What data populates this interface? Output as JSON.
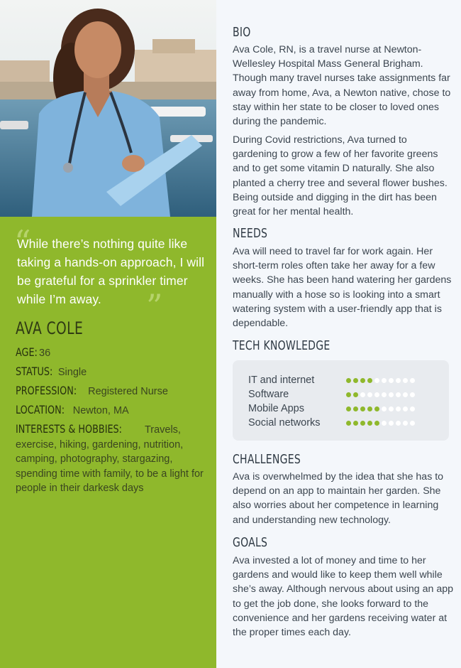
{
  "profile": {
    "quote": "While there’s nothing quite like taking a hands-on approach, I will be grateful for a sprinkler timer while I’m away.",
    "name": "AVA COLE",
    "facts": [
      {
        "label": "AGE:",
        "value": "36"
      },
      {
        "label": "STATUS:",
        "value": "Single"
      },
      {
        "label": "PROFESSION:",
        "value": "Registered Nurse"
      },
      {
        "label": "LOCATION:",
        "value": "Newton, MA"
      },
      {
        "label": "INTERESTS & HOBBIES:",
        "value": "Travels, exercise, hiking, gardening, nutrition, camping, photography, stargazing, spending time with family, to be a light for people in their darkesk days"
      }
    ]
  },
  "bio": {
    "title": "BIO",
    "p1": "Ava Cole, RN, is a travel nurse at Newton-Wellesley Hospital Mass General Brigham. Though many travel nurses take assignments far away from home, Ava, a Newton native, chose to stay within her state to be closer to loved ones during the pandemic.",
    "p2": "During Covid restrictions, Ava turned to gardening to grow a few of her favorite greens and to get some vitamin D naturally. She also planted a cherry tree and several flower bushes. Being outside and digging in the dirt has been great for her mental health."
  },
  "needs": {
    "title": "NEEDS",
    "text": "Ava will need to travel far for work again. Her short-term roles often take her away for a few weeks. She has been hand watering her gardens manually with a hose so is looking into a smart watering system with a user-friendly app that is dependable."
  },
  "tech": {
    "title": "TECH KNOWLEDGE",
    "max": 10,
    "items": [
      {
        "label": "IT and internet",
        "level": 4
      },
      {
        "label": "Software",
        "level": 2
      },
      {
        "label": "Mobile Apps",
        "level": 5
      },
      {
        "label": "Social networks",
        "level": 5
      }
    ]
  },
  "challenges": {
    "title": "CHALLENGES",
    "text": "Ava is overwhelmed by the idea that she has to depend on an app to maintain her garden. She also worries about her competence in learning and understanding new technology."
  },
  "goals": {
    "title": "GOALS",
    "text": "Ava invested a lot of money and time to her gardens and would like to keep them well while she’s away. Although nervous about using an app to get the job done, she looks forward to the convenience and her gardens receiving water at the proper times each day."
  },
  "colors": {
    "accent": "#8fb82c",
    "panel": "#e8ebef",
    "background": "#f4f7fb"
  }
}
